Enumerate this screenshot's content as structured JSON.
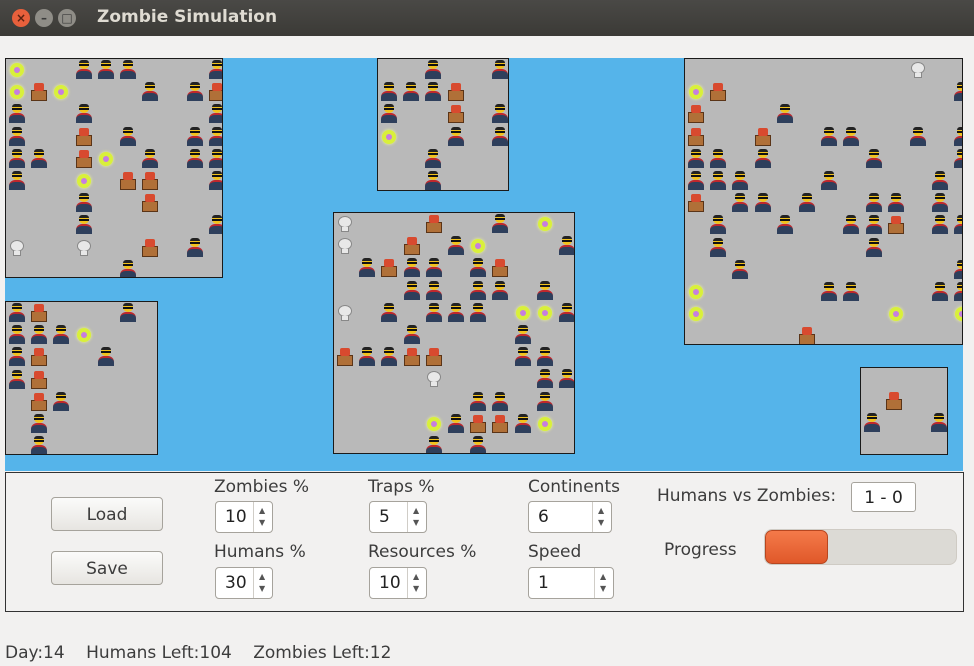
{
  "window": {
    "title": "Zombie Simulation"
  },
  "controls": {
    "load_label": "Load",
    "save_label": "Save",
    "zombies_label": "Zombies %",
    "zombies_value": "10",
    "humans_label": "Humans %",
    "humans_value": "30",
    "traps_label": "Traps %",
    "traps_value": "5",
    "resources_label": "Resources %",
    "resources_value": "10",
    "continents_label": "Continents",
    "continents_value": "6",
    "speed_label": "Speed",
    "speed_value": "1",
    "score_label": "Humans vs Zombies:",
    "score_value": "1 - 0",
    "progress_label": "Progress",
    "progress_fraction": 0.33
  },
  "status": {
    "day": "Day:14",
    "humans_left": "Humans Left:104",
    "zombies_left": "Zombies Left:12"
  },
  "colors": {
    "water": "#55b4ea",
    "land": "#b9b9b9",
    "progress": "#e8602f"
  },
  "entity_legend": {
    "h": "human-icon",
    "z": "zombie-icon",
    "r": "resource-icon",
    "s": "skull-icon"
  },
  "continents": [
    {
      "name": "continent-1",
      "rows": [
        "z..hhh...h",
        "zrz...h.hr",
        "h..h.....h",
        "h..r.h..hh",
        "hh.rz.h.hh",
        "h..z.rr..h",
        "...h..r...",
        "...h.....h",
        "s..s..r.h.",
        ".....h...."
      ]
    },
    {
      "name": "continent-2",
      "rows": [
        "..h..hh",
        "hhhr..h",
        "h..r.hh",
        "z..h.hh",
        "..h....",
        "..h...."
      ]
    },
    {
      "name": "continent-3",
      "rows": [
        "s...r..h.z..",
        "s..r.hz...hh",
        ".hrhh.hr....",
        "...hh.hh.h..",
        "s.h.hhh.zzh.",
        "...h....h...",
        "rhhrr...hh..",
        "....s....hh.",
        "......hh.h..",
        "....zhrrhz..",
        "....h.h.....",
        ".s.....h...."
      ]
    },
    {
      "name": "continent-4",
      "rows": [
        "..........s..rrrrrr",
        "zr..........h....h.",
        "r...h........h.....",
        "r..r..hh..h.hz.h..h",
        "hh.h....h...h.....h",
        "hhh...h....h...hh..",
        "r.hh.h..hh.h...h.h.",
        ".h..h..hhr.hh..z.hh",
        ".h......h........hr",
        "..h.........h....hr",
        "z.....hh...hh..h.hh",
        "z........z..z.ssss",
        ".....r.........r...",
        "...h....s.....h..z.",
        "h........h......h.."
      ]
    },
    {
      "name": "continent-5",
      "rows": [
        "hr...h.",
        "hhhz...",
        "hr..h..",
        "hr.....",
        ".rh....",
        ".h.....",
        ".h....."
      ]
    },
    {
      "name": "continent-6",
      "rows": [
        "....",
        ".r..",
        "h..h"
      ]
    }
  ]
}
